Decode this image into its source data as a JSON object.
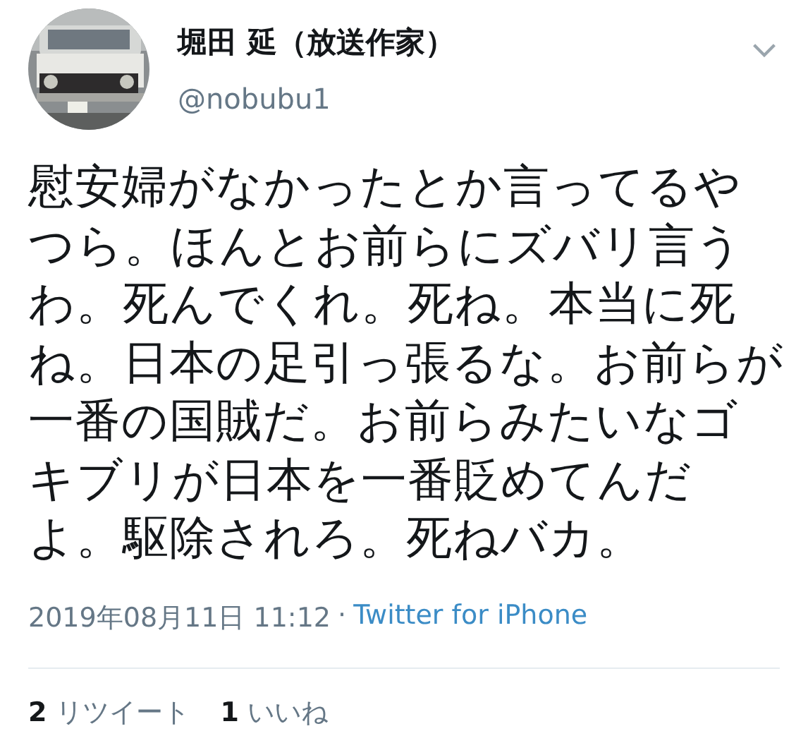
{
  "author": {
    "name": "堀田 延（放送作家）",
    "handle": "@nobubu1"
  },
  "tweet": {
    "text": "慰安婦がなかったとか言ってるやつら。ほんとお前らにズバリ言うわ。死んでくれ。死ね。本当に死ね。日本の足引っ張るな。お前らが一番の国賊だ。お前らみたいなゴキブリが日本を一番貶めてんだよ。駆除されろ。死ねバカ。"
  },
  "meta": {
    "timestamp": "2019年08月11日 11:12",
    "separator": "·",
    "source": "Twitter for iPhone"
  },
  "stats": [
    {
      "count": "2",
      "label": "リツイート"
    },
    {
      "count": "1",
      "label": "いいね"
    }
  ]
}
